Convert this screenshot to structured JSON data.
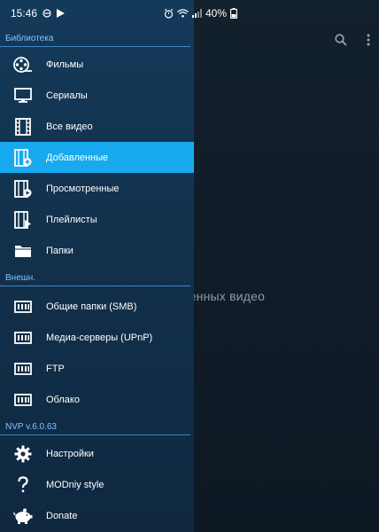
{
  "status_bar": {
    "time": "15:46",
    "battery": "40%"
  },
  "background": {
    "empty_text": "авленных видео"
  },
  "drawer": {
    "sections": [
      {
        "title": "Библиотека",
        "items": [
          {
            "label": "Фильмы",
            "icon": "film-reel-icon",
            "active": false
          },
          {
            "label": "Сериалы",
            "icon": "tv-monitor-icon",
            "active": false
          },
          {
            "label": "Все видео",
            "icon": "film-strip-icon",
            "active": false
          },
          {
            "label": "Добавленные",
            "icon": "film-add-icon",
            "active": true
          },
          {
            "label": "Просмотренные",
            "icon": "film-watched-icon",
            "active": false
          },
          {
            "label": "Плейлисты",
            "icon": "playlist-icon",
            "active": false
          },
          {
            "label": "Папки",
            "icon": "folder-icon",
            "active": false
          }
        ]
      },
      {
        "title": "Внешн.",
        "items": [
          {
            "label": "Общие папки (SMB)",
            "icon": "network-drive-icon",
            "active": false
          },
          {
            "label": "Медиа-серверы (UPnP)",
            "icon": "network-drive-icon",
            "active": false
          },
          {
            "label": "FTP",
            "icon": "network-drive-icon",
            "active": false
          },
          {
            "label": "Облако",
            "icon": "network-drive-icon",
            "active": false
          }
        ]
      },
      {
        "title": "NVP v.6.0.63",
        "items": [
          {
            "label": "Настройки",
            "icon": "gear-icon",
            "active": false
          },
          {
            "label": "MODniy style",
            "icon": "question-mark-icon",
            "active": false
          },
          {
            "label": "Donate",
            "icon": "piggy-bank-icon",
            "active": false
          }
        ]
      }
    ]
  },
  "colors": {
    "accent": "#19a9ee",
    "drawer_bg": "#143a5a",
    "section_title": "#7fc6ff"
  }
}
